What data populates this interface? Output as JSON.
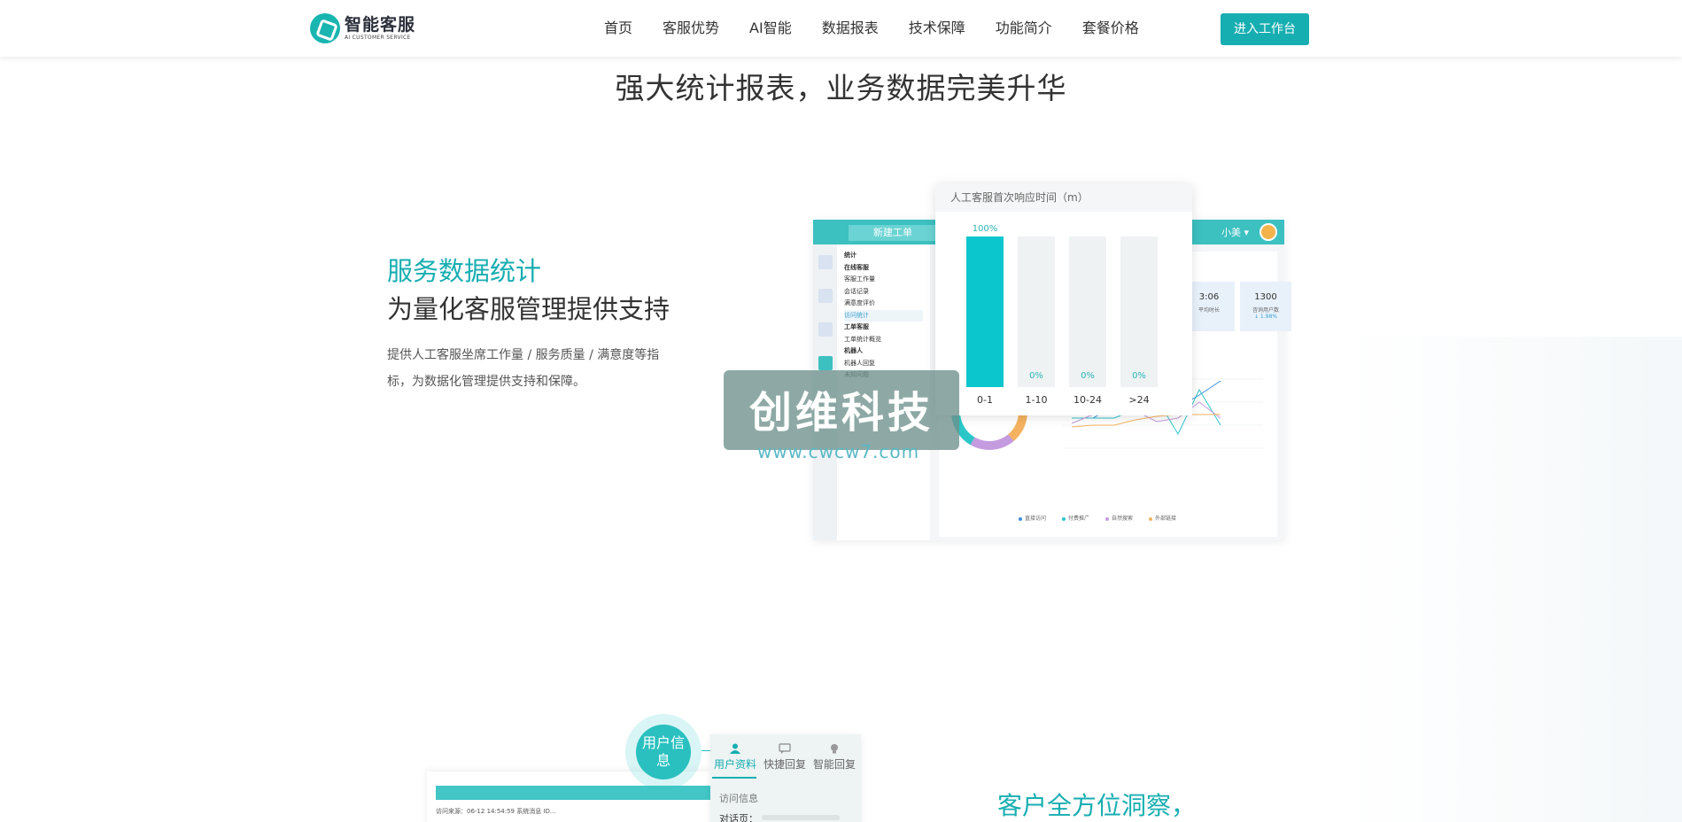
{
  "brand": {
    "name": "智能客服",
    "tagline": "AI CUSTOMER SERVICE"
  },
  "nav": {
    "items": [
      "首页",
      "客服优势",
      "AI智能",
      "数据报表",
      "技术保障",
      "功能简介",
      "套餐价格"
    ],
    "cta": "进入工作台"
  },
  "section": {
    "title": "强大统计报表，业务数据完美升华"
  },
  "feature": {
    "highlight": "服务数据统计",
    "subtitle": "为量化客服管理提供支持",
    "description": "提供人工客服坐席工作量 / 服务质量 / 满意度等指标，为数据化管理提供支持和保障。"
  },
  "dashboard": {
    "new_ticket": "新建工单",
    "user_name": "小美 ▾",
    "menu": [
      {
        "text": "统计",
        "style": "bold"
      },
      {
        "text": "在线客服",
        "style": "bold"
      },
      {
        "text": "客服工作量",
        "style": ""
      },
      {
        "text": "会话记录",
        "style": ""
      },
      {
        "text": "满意度评价",
        "style": ""
      },
      {
        "text": "访问统计",
        "style": "active"
      },
      {
        "text": "",
        "style": ""
      },
      {
        "text": "工单客服",
        "style": "bold"
      },
      {
        "text": "工单统计概览",
        "style": ""
      },
      {
        "text": "",
        "style": ""
      },
      {
        "text": "机器人",
        "style": "bold"
      },
      {
        "text": "机器人回复",
        "style": ""
      },
      {
        "text": "未知问题",
        "style": ""
      }
    ],
    "stats": [
      {
        "num": "3:06",
        "label": "平均时长",
        "change": ""
      },
      {
        "num": "1300",
        "label": "咨询用户数",
        "change": "↓ 1.98%"
      }
    ],
    "donut_label": "付费推广",
    "legend": [
      {
        "label": "直接访问",
        "color": "#3b8ee0"
      },
      {
        "label": "付费推广",
        "color": "#2bc6c8"
      },
      {
        "label": "自然搜索",
        "color": "#c59be0"
      },
      {
        "label": "外部链接",
        "color": "#f4b260"
      }
    ]
  },
  "response_popup": {
    "title": "人工客服首次响应时间（m）"
  },
  "chart_data": {
    "type": "bar",
    "title": "人工客服首次响应时间（m）",
    "categories": [
      "0-1",
      "1-10",
      "10-24",
      ">24"
    ],
    "values": [
      100,
      0,
      0,
      0
    ],
    "value_labels": [
      "100%",
      "0%",
      "0%",
      "0%"
    ],
    "ylim": [
      0,
      100
    ],
    "color": "#0bc6cc"
  },
  "watermark": {
    "text": "创维科技",
    "url": "www.cwcw7.com"
  },
  "insight": {
    "ring_label": "用户信息",
    "tabs": [
      "用户资料",
      "快捷回复",
      "智能回复"
    ],
    "visit_info": "访问信息",
    "page_label": "对话页：",
    "chat_meta": "访问来源：06-12 14:54:59  系统消息 ID...",
    "title": "客户全方位洞察，"
  }
}
